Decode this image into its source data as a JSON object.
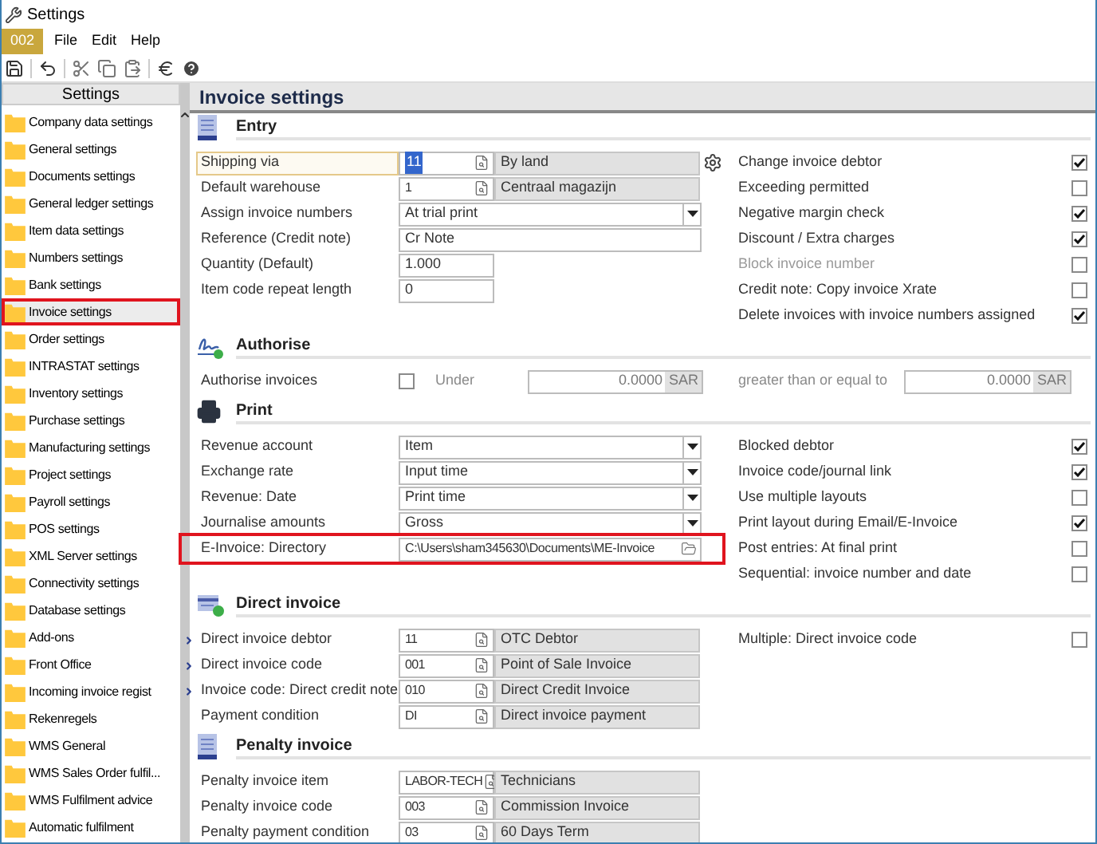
{
  "window": {
    "title": "Settings"
  },
  "menu": {
    "company": "002",
    "items": [
      "File",
      "Edit",
      "Help"
    ]
  },
  "sidebar": {
    "title": "Settings",
    "items": [
      {
        "label": "Company data settings",
        "selected": false,
        "highlighted": false
      },
      {
        "label": "General settings",
        "selected": false,
        "highlighted": false
      },
      {
        "label": "Documents settings",
        "selected": false,
        "highlighted": false
      },
      {
        "label": "General ledger settings",
        "selected": false,
        "highlighted": false
      },
      {
        "label": "Item data settings",
        "selected": false,
        "highlighted": false
      },
      {
        "label": "Numbers settings",
        "selected": false,
        "highlighted": false
      },
      {
        "label": "Bank settings",
        "selected": false,
        "highlighted": false
      },
      {
        "label": "Invoice settings",
        "selected": true,
        "highlighted": true
      },
      {
        "label": "Order settings",
        "selected": false,
        "highlighted": false
      },
      {
        "label": "INTRASTAT settings",
        "selected": false,
        "highlighted": false
      },
      {
        "label": "Inventory settings",
        "selected": false,
        "highlighted": false
      },
      {
        "label": "Purchase settings",
        "selected": false,
        "highlighted": false
      },
      {
        "label": "Manufacturing settings",
        "selected": false,
        "highlighted": false
      },
      {
        "label": "Project settings",
        "selected": false,
        "highlighted": false
      },
      {
        "label": "Payroll settings",
        "selected": false,
        "highlighted": false
      },
      {
        "label": "POS settings",
        "selected": false,
        "highlighted": false
      },
      {
        "label": "XML Server settings",
        "selected": false,
        "highlighted": false
      },
      {
        "label": "Connectivity settings",
        "selected": false,
        "highlighted": false
      },
      {
        "label": "Database settings",
        "selected": false,
        "highlighted": false
      },
      {
        "label": "Add-ons",
        "selected": false,
        "highlighted": false
      },
      {
        "label": "Front Office",
        "selected": false,
        "highlighted": false
      },
      {
        "label": "Incoming invoice regist",
        "selected": false,
        "highlighted": false
      },
      {
        "label": "Rekenregels",
        "selected": false,
        "highlighted": false
      },
      {
        "label": "WMS General",
        "selected": false,
        "highlighted": false
      },
      {
        "label": "WMS Sales Order fulfil...",
        "selected": false,
        "highlighted": false
      },
      {
        "label": "WMS Fulfilment advice",
        "selected": false,
        "highlighted": false
      },
      {
        "label": "Automatic fulfilment",
        "selected": false,
        "highlighted": false
      }
    ]
  },
  "page_title": "Invoice settings",
  "sections": [
    {
      "title": "Entry",
      "kind": "entry",
      "fields": [
        {
          "kind": "lookup",
          "label": "Shipping via",
          "code": "11",
          "description": "By land",
          "focused": true,
          "expandable": false,
          "highlighted": false,
          "gear": true
        },
        {
          "kind": "lookup",
          "label": "Default warehouse",
          "code": "1",
          "description": "Centraal magazijn",
          "focused": false,
          "expandable": false,
          "highlighted": false,
          "gear": false
        },
        {
          "kind": "dropdown",
          "label": "Assign invoice numbers",
          "value": "At trial print",
          "focused": false,
          "expandable": false,
          "highlighted": false,
          "gear": false
        },
        {
          "kind": "text",
          "label": "Reference (Credit note)",
          "value": "Cr Note",
          "focused": false,
          "expandable": false,
          "highlighted": false,
          "gear": false
        },
        {
          "kind": "number",
          "label": "Quantity (Default)",
          "value": "1.000",
          "focused": false,
          "expandable": false,
          "highlighted": false,
          "gear": false
        },
        {
          "kind": "number",
          "label": "Item code repeat length",
          "value": "0",
          "focused": false,
          "expandable": false,
          "highlighted": false,
          "gear": false
        }
      ],
      "options": [
        {
          "label": "Change invoice debtor",
          "checked": true,
          "disabled": false
        },
        {
          "label": "Exceeding permitted",
          "checked": false,
          "disabled": false
        },
        {
          "label": "Negative margin check",
          "checked": true,
          "disabled": false
        },
        {
          "label": "Discount / Extra charges",
          "checked": true,
          "disabled": false
        },
        {
          "label": "Block invoice number",
          "checked": false,
          "disabled": true
        },
        {
          "label": "Credit note: Copy invoice Xrate",
          "checked": false,
          "disabled": false
        },
        {
          "label": "Delete invoices with invoice numbers assigned",
          "checked": true,
          "disabled": false
        }
      ]
    },
    {
      "title": "Authorise",
      "kind": "authorise",
      "fields": [
        {
          "kind": "threshold",
          "label": "Authorise invoices",
          "checked": false,
          "under": {
            "label": "Under",
            "amount": "0.0000",
            "currency": "SAR"
          },
          "over": {
            "label": "greater than or equal to",
            "amount": "0.0000",
            "currency": "SAR"
          }
        }
      ]
    },
    {
      "title": "Print",
      "kind": "print",
      "fields": [
        {
          "kind": "dropdown",
          "label": "Revenue account",
          "value": "Item",
          "focused": false,
          "expandable": false,
          "highlighted": false,
          "gear": false
        },
        {
          "kind": "dropdown",
          "label": "Exchange rate",
          "value": "Input time",
          "focused": false,
          "expandable": false,
          "highlighted": false,
          "gear": false
        },
        {
          "kind": "dropdown",
          "label": "Revenue: Date",
          "value": "Print time",
          "focused": false,
          "expandable": false,
          "highlighted": false,
          "gear": false
        },
        {
          "kind": "dropdown",
          "label": "Journalise amounts",
          "value": "Gross",
          "focused": false,
          "expandable": false,
          "highlighted": false,
          "gear": false
        },
        {
          "kind": "folder",
          "label": "E-Invoice: Directory",
          "value": "C:\\Users\\sham345630\\Documents\\ME-Invoice",
          "focused": false,
          "expandable": false,
          "highlighted": true,
          "gear": false
        }
      ],
      "options": [
        {
          "label": "Blocked debtor",
          "checked": true,
          "disabled": false
        },
        {
          "label": "Invoice code/journal link",
          "checked": true,
          "disabled": false
        },
        {
          "label": "Use multiple layouts",
          "checked": false,
          "disabled": false
        },
        {
          "label": "Print layout during Email/E-Invoice",
          "checked": true,
          "disabled": false
        },
        {
          "label": "Post entries: At final print",
          "checked": false,
          "disabled": false
        },
        {
          "label": "Sequential: invoice number and date",
          "checked": false,
          "disabled": false
        }
      ]
    },
    {
      "title": "Direct invoice",
      "kind": "direct",
      "fields": [
        {
          "kind": "lookup",
          "label": "Direct invoice debtor",
          "code": "11",
          "description": "OTC Debtor",
          "focused": false,
          "expandable": true,
          "highlighted": false,
          "gear": false
        },
        {
          "kind": "lookup",
          "label": "Direct invoice code",
          "code": "001",
          "description": "Point of Sale Invoice",
          "focused": false,
          "expandable": true,
          "highlighted": false,
          "gear": false
        },
        {
          "kind": "lookup",
          "label": "Invoice code: Direct credit note",
          "code": "010",
          "description": "Direct Credit Invoice",
          "focused": false,
          "expandable": true,
          "highlighted": false,
          "gear": false
        },
        {
          "kind": "lookup",
          "label": "Payment condition",
          "code": "DI",
          "description": "Direct invoice payment",
          "focused": false,
          "expandable": false,
          "highlighted": false,
          "gear": false
        }
      ],
      "options": [
        {
          "label": "Multiple: Direct invoice code",
          "checked": false,
          "disabled": false
        }
      ]
    },
    {
      "title": "Penalty invoice",
      "kind": "entry",
      "fields": [
        {
          "kind": "lookup",
          "label": "Penalty invoice item",
          "code": "LABOR-TECH",
          "description": "Technicians",
          "focused": false,
          "expandable": false,
          "highlighted": false,
          "gear": false
        },
        {
          "kind": "lookup",
          "label": "Penalty invoice code",
          "code": "003",
          "description": "Commission Invoice",
          "focused": false,
          "expandable": false,
          "highlighted": false,
          "gear": false
        },
        {
          "kind": "lookup",
          "label": "Penalty payment condition",
          "code": "03",
          "description": "60 Days Term",
          "focused": false,
          "expandable": false,
          "highlighted": false,
          "gear": false
        }
      ]
    }
  ]
}
